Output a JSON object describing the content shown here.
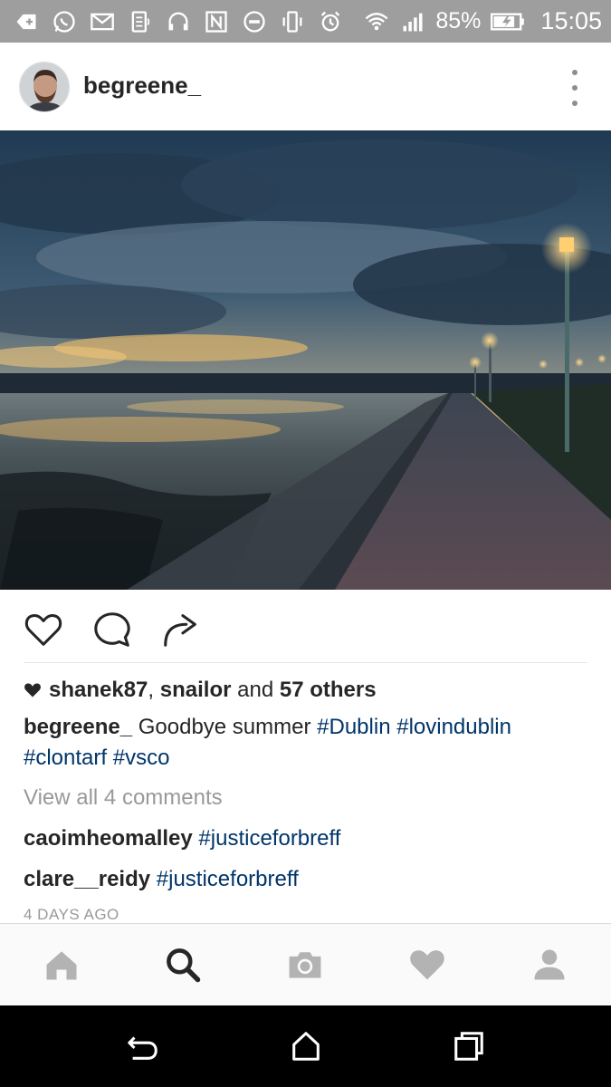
{
  "status_bar": {
    "battery_percent": "85%",
    "time": "15:05",
    "left_icons": [
      "add-icon",
      "whatsapp-icon",
      "gmail-icon",
      "sim-icon",
      "headphones-icon",
      "nfc-icon",
      "do-not-disturb-icon",
      "vibrate-icon",
      "alarm-icon"
    ],
    "right_icons": [
      "wifi-icon",
      "signal-icon",
      "battery-charging-icon"
    ]
  },
  "post": {
    "username": "begreene_",
    "liked_by": {
      "user1": "shanek87",
      "separator": ",",
      "user2": "snailor",
      "and_text": "and",
      "others": "57 others"
    },
    "caption": {
      "username": "begreene_",
      "text": "Goodbye summer",
      "hashtags": [
        "#Dublin",
        "#lovindublin",
        "#clontarf",
        "#vsco"
      ]
    },
    "view_all_comments": "View all 4 comments",
    "comments": [
      {
        "username": "caoimheomalley",
        "text": "#justiceforbreff"
      },
      {
        "username": "clare__reidy",
        "text": "#justiceforbreff"
      }
    ],
    "timestamp": "4 DAYS AGO"
  },
  "tab_bar": [
    "home-icon",
    "search-icon",
    "camera-icon",
    "heart-icon",
    "profile-icon"
  ],
  "colors": {
    "status_bar": "#9e9e9e",
    "hashtag": "#003569",
    "secondary_text": "#999999",
    "tab_icon_inactive": "#b3b3b3",
    "tab_icon_active": "#262626"
  }
}
